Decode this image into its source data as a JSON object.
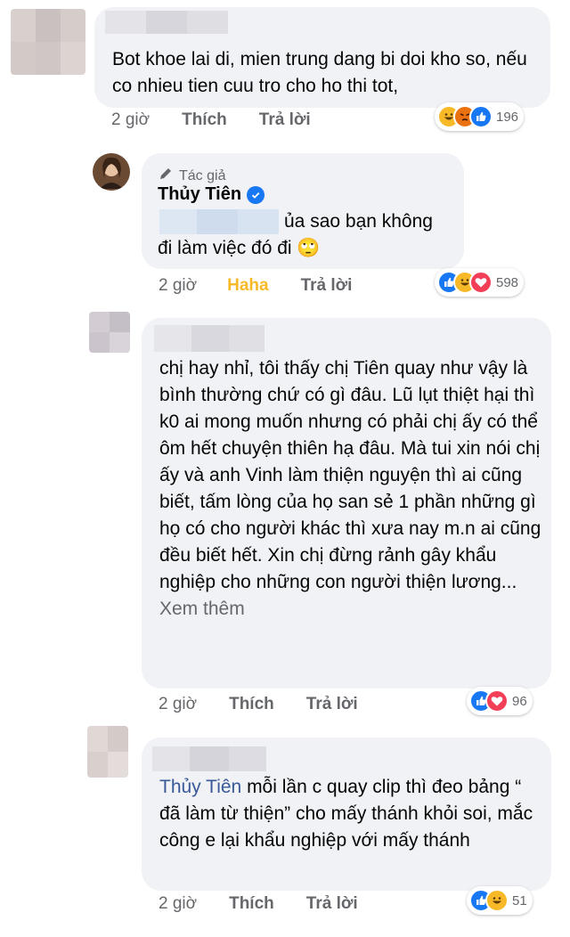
{
  "comments": [
    {
      "text": "Bot khoe lai di, mien trung dang bi doi kho so, nếu co nhieu tien cuu tro cho ho thi tot,",
      "time": "2 giờ",
      "like_label": "Thích",
      "reply_label": "Trả lời",
      "reaction_count": "196",
      "reactions": [
        "haha-icon",
        "angry-icon",
        "like-icon"
      ]
    },
    {
      "author_badge": "Tác giả",
      "author_name": "Thủy Tiên",
      "text": "ủa sao bạn không đi làm việc đó đi 🙄",
      "time": "2 giờ",
      "like_label": "Haha",
      "reply_label": "Trả lời",
      "reaction_count": "598",
      "reactions": [
        "like-icon",
        "haha-icon",
        "love-icon"
      ]
    },
    {
      "text": "chị hay nhỉ, tôi thấy chị Tiên quay như vậy là bình thường chứ có gì đâu. Lũ lụt thiệt hại thì k0 ai mong muốn nhưng có phải chị ấy có thể ôm hết chuyện thiên hạ đâu. Mà tui xin nói chị ấy và anh Vinh làm thiện nguyện thì ai cũng biết, tấm lòng của họ san sẻ 1 phần những gì họ có cho người khác thì xưa nay m.n ai cũng đều biết hết. Xin chị đừng rảnh gây khẩu nghiệp cho những con người thiện lương...",
      "see_more": "Xem thêm",
      "time": "2 giờ",
      "like_label": "Thích",
      "reply_label": "Trả lời",
      "reaction_count": "96",
      "reactions": [
        "like-icon",
        "love-icon"
      ]
    },
    {
      "mention": "Thủy Tiên",
      "text": "mỗi lần c quay clip thì đeo bảng “ đã làm từ thiện” cho mấy thánh khỏi soi, mắc công e lại khẩu nghiệp với mấy thánh",
      "time": "2 giờ",
      "like_label": "Thích",
      "reply_label": "Trả lời",
      "reaction_count": "51",
      "reactions": [
        "like-icon",
        "haha-icon"
      ]
    }
  ],
  "colors": {
    "bubble": "#f0f2f5",
    "link": "#385898",
    "meta": "#65676b",
    "like": "#1877f2",
    "love": "#f33e58",
    "haha": "#f7b928"
  }
}
